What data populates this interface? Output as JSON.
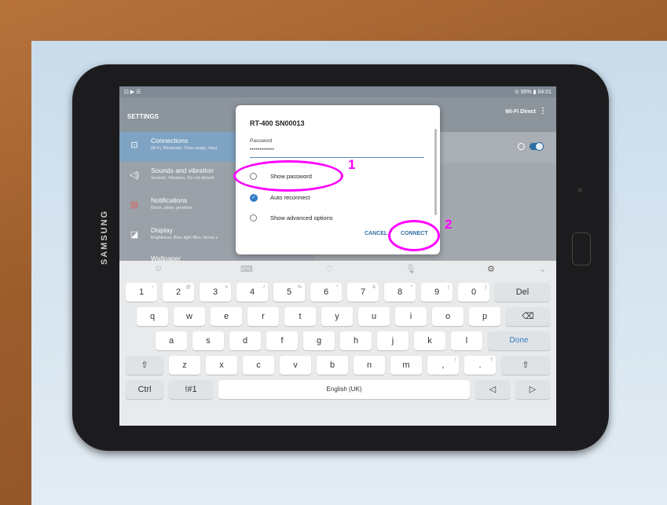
{
  "statusbar": {
    "left": "⊡ ▶ ☰",
    "right": "⊙ 95% ▮ 04:01"
  },
  "header": {
    "title": "SETTINGS",
    "wifi_direct": "Wi-Fi Direct",
    "more": "⋮"
  },
  "sidebar": {
    "items": [
      {
        "title": "Connections",
        "subtitle": "Wi-Fi, Bluetooth, Data usage, Airpl",
        "icon": "connections-icon",
        "glyph": "⊡"
      },
      {
        "title": "Sounds and vibration",
        "subtitle": "Sounds, Vibration, Do not disturb",
        "icon": "sound-icon",
        "glyph": "◁)"
      },
      {
        "title": "Notifications",
        "subtitle": "Block, allow, prioritize",
        "icon": "notifications-icon",
        "glyph": "▤"
      },
      {
        "title": "Display",
        "subtitle": "Brightness, Blue light filter, Home s",
        "icon": "display-icon",
        "glyph": "◪"
      },
      {
        "title": "Wallpaper",
        "subtitle": "",
        "icon": "wallpaper-icon",
        "glyph": "▭"
      }
    ]
  },
  "dialog": {
    "title": "RT-400 SN00013",
    "password_label": "Password",
    "password_value": "••••••••••••",
    "options": [
      {
        "label": "Show password",
        "checked": false
      },
      {
        "label": "Auto reconnect",
        "checked": true
      },
      {
        "label": "Show advanced options",
        "checked": false
      }
    ],
    "cancel": "CANCEL",
    "connect": "CONNECT"
  },
  "keyboard": {
    "toolbar": [
      "☺",
      "⌨",
      "♡",
      "🎙",
      "⚙",
      "⌄"
    ],
    "row1": [
      {
        "k": "1",
        "s": "~"
      },
      {
        "k": "2",
        "s": "@"
      },
      {
        "k": "3",
        "s": "#"
      },
      {
        "k": "4",
        "s": "/"
      },
      {
        "k": "5",
        "s": "%"
      },
      {
        "k": "6",
        "s": "^"
      },
      {
        "k": "7",
        "s": "&"
      },
      {
        "k": "8",
        "s": "*"
      },
      {
        "k": "9",
        "s": "("
      },
      {
        "k": "0",
        "s": ")"
      }
    ],
    "del": "Del",
    "row2": [
      "q",
      "w",
      "e",
      "r",
      "t",
      "y",
      "u",
      "i",
      "o",
      "p"
    ],
    "backspace": "⌫",
    "row3": [
      "a",
      "s",
      "d",
      "f",
      "g",
      "h",
      "j",
      "k",
      "l"
    ],
    "done": "Done",
    "shift": "⇧",
    "row4": [
      "z",
      "x",
      "c",
      "v",
      "b",
      "n",
      "m"
    ],
    "comma": {
      "k": ",",
      "s": "!"
    },
    "period": {
      "k": ".",
      "s": "?"
    },
    "ctrl": "Ctrl",
    "symbols": "!#1",
    "space": "English (UK)",
    "left": "◁",
    "right": "▷"
  },
  "annotations": {
    "one": "1",
    "two": "2",
    "color": "#ff00ff"
  },
  "device": {
    "brand": "SAMSUNG"
  }
}
